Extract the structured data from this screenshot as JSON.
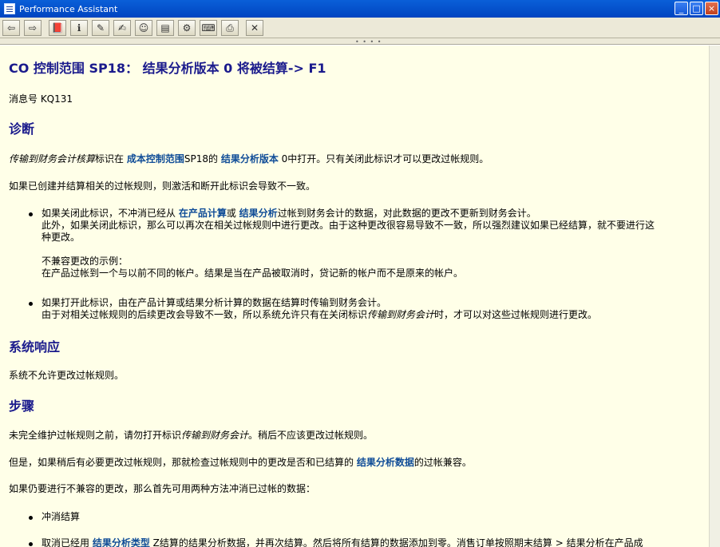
{
  "window": {
    "title": "Performance Assistant",
    "buttons": [
      "_",
      "□",
      "×"
    ]
  },
  "toolbar": {
    "icons": [
      "back-icon",
      "forward-icon",
      "book-icon",
      "technical-info-icon",
      "edit-icon",
      "comment-icon",
      "user-icon",
      "table-icon",
      "settings-icon",
      "glossary-icon",
      "print-icon",
      "exit-icon"
    ],
    "glyphs": [
      "⇦",
      "⇨",
      "📕",
      "ℹ",
      "✎",
      "✍",
      "☺",
      "▤",
      "⚙",
      "⌨",
      "⎙",
      "✕"
    ]
  },
  "doc": {
    "title": "CO 控制范围  SP18： 结果分析版本  0 将被结算-> F1",
    "message_no": "消息号  KQ131",
    "diagnosis_heading": "诊断",
    "diag1": {
      "a": "传输到财务会计核算",
      "b": "标识在 ",
      "c": "成本控制范围",
      "d": "SP18的 ",
      "e": "结果分析版本",
      "f": " 0中打开。只有关闭此标识才可以更改过帐规则。"
    },
    "diag2": "如果已创建并结算相关的过帐规则，则激活和断开此标识会导致不一致。",
    "bullet1": {
      "l1a": "如果关闭此标识，不冲消已经从 ",
      "l1b": "在产品计算",
      "l1c": "或 ",
      "l1d": "结果分析",
      "l1e": "过帐到财务会计的数据，对此数据的更改不更新到财务会计。",
      "l2": "此外，如果关闭此标识，那么可以再次在相关过帐规则中进行更改。由于这种更改很容易导致不一致，所以强烈建议如果已经结算，就不要进行这",
      "l3": "种更改。",
      "l4": "不兼容更改的示例：",
      "l5": "在产品过帐到一个与以前不同的帐户。结果是当在产品被取消时，贷记新的帐户而不是原来的帐户。"
    },
    "bullet2": {
      "l1": "如果打开此标识，由在产品计算或结果分析计算的数据在结算时传输到财务会计。",
      "l2a": "由于对相关过帐规则的后续更改会导致不一致，所以系统允许只有在关闭标识",
      "l2b": "传输到财务会计",
      "l2c": "时，才可以对这些过帐规则进行更改。"
    },
    "response_heading": "系统响应",
    "response": "系统不允许更改过帐规则。",
    "steps_heading": "步骤",
    "step1a": "未完全维护过帐规则之前，请勿打开标识",
    "step1b": "传输到财务会计",
    "step1c": "。稍后不应该更改过帐规则。",
    "step2a": "但是，如果稍后有必要更改过帐规则，那就检查过帐规则中的更改是否和已结算的 ",
    "step2b": "结果分析数据",
    "step2c": "的过帐兼容。",
    "step3": "如果仍要进行不兼容的更改，那么首先可用两种方法冲消已过帐的数据：",
    "bullet3": "冲消结算",
    "bullet4a": "取消已经用 ",
    "bullet4b": "结果分析类型",
    "bullet4c": " Z结算的结果分析数据，并再次结算。然后将所有结算的数据添加到零。消售订单按照期末结算 > 结果分析在产品成"
  }
}
